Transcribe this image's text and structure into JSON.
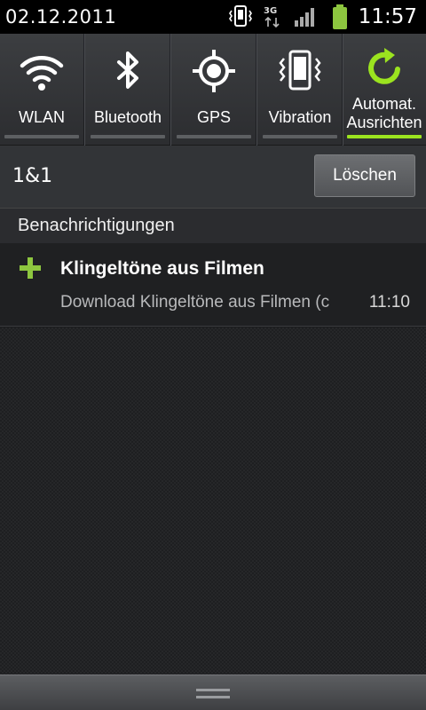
{
  "status_bar": {
    "date": "02.12.2011",
    "time": "11:57",
    "network": "3G",
    "icons": [
      "vibrate-icon",
      "network-3g-icon",
      "signal-icon",
      "battery-icon"
    ],
    "battery_color": "#8dc63f"
  },
  "quick_settings": {
    "toggles": [
      {
        "label": "WLAN",
        "icon": "wifi-icon",
        "active": false
      },
      {
        "label": "Bluetooth",
        "icon": "bluetooth-icon",
        "active": false
      },
      {
        "label": "GPS",
        "icon": "gps-icon",
        "active": false
      },
      {
        "label": "Vibration",
        "icon": "vibration-icon",
        "active": false
      },
      {
        "label_line1": "Automat.",
        "label_line2": "Ausrichten",
        "icon": "auto-rotate-icon",
        "active": true
      }
    ],
    "active_color": "#9be31f"
  },
  "operator": {
    "name": "1&1",
    "clear_label": "Löschen"
  },
  "notifications": {
    "header": "Benachrichtigungen",
    "items": [
      {
        "icon": "plus-icon",
        "title": "Klingeltöne aus Filmen",
        "text": "Download Klingeltöne aus Filmen  (c",
        "time": "11:10"
      }
    ]
  }
}
